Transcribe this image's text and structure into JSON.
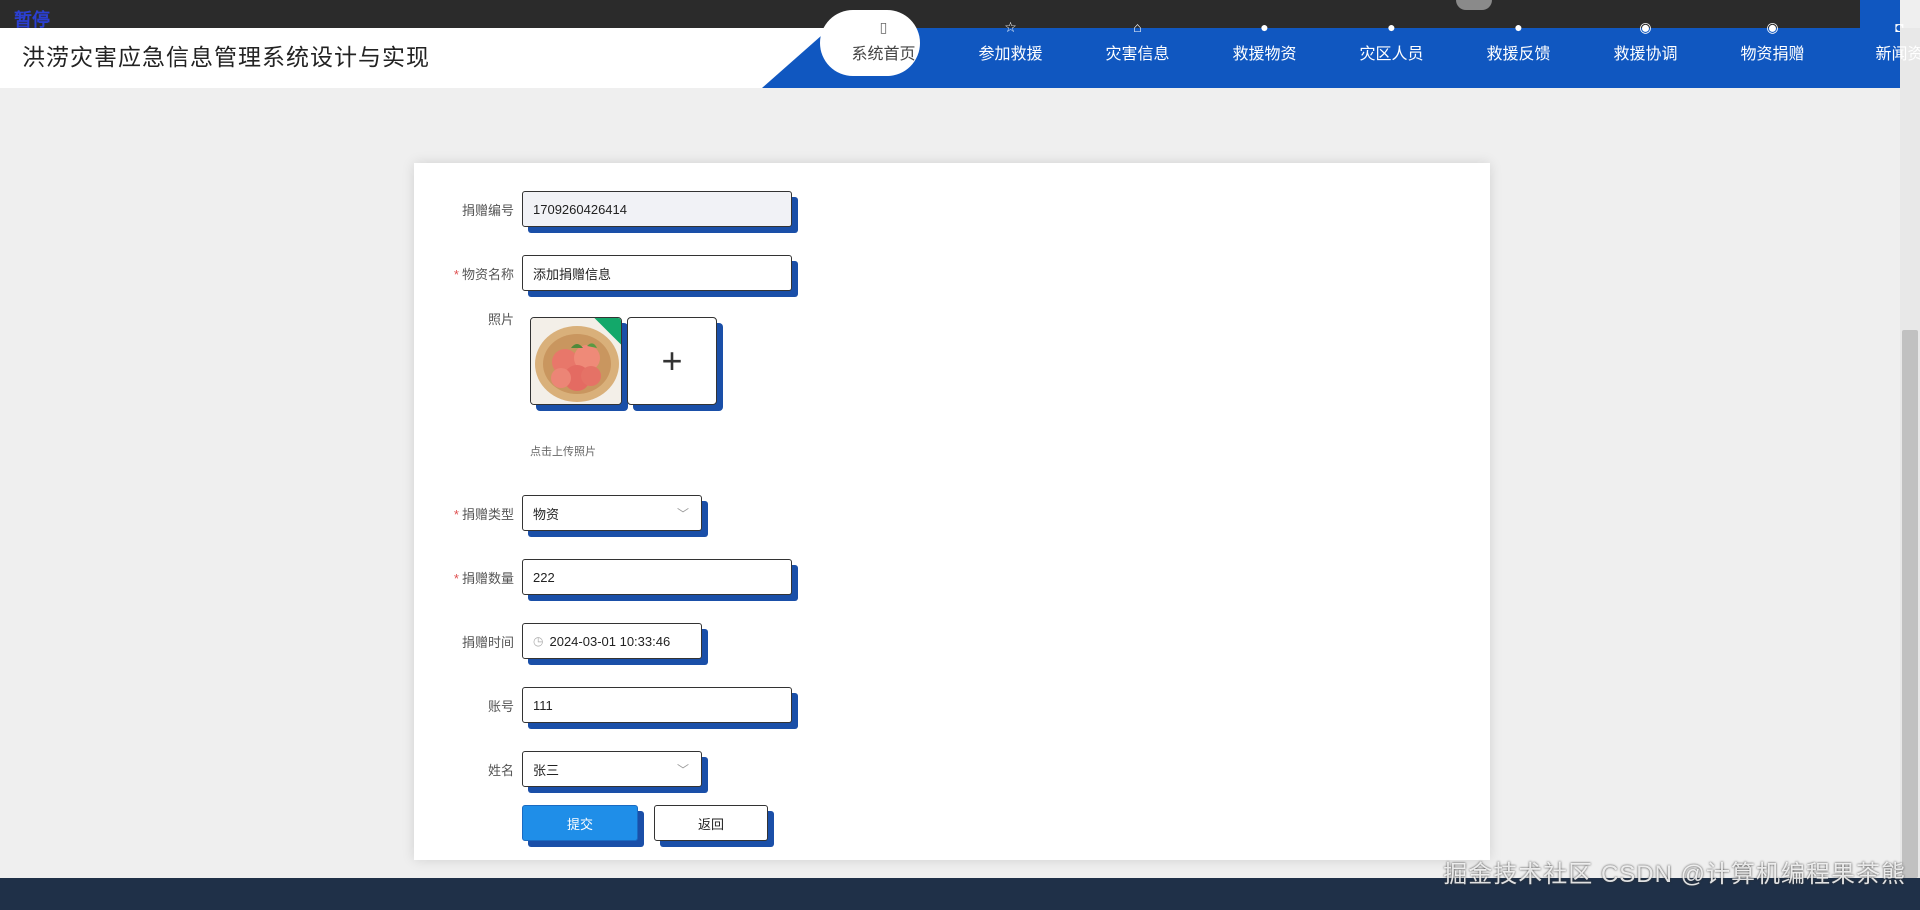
{
  "overlay": {
    "pause_label": "暂停"
  },
  "header": {
    "title": "洪涝灾害应急信息管理系统设计与实现",
    "nav": [
      {
        "label": "系统首页",
        "icon": "home-icon",
        "active": true
      },
      {
        "label": "参加救援",
        "icon": "star-icon",
        "active": false
      },
      {
        "label": "灾害信息",
        "icon": "building-icon",
        "active": false
      },
      {
        "label": "救援物资",
        "icon": "info-icon",
        "active": false
      },
      {
        "label": "灾区人员",
        "icon": "info-icon",
        "active": false
      },
      {
        "label": "救援反馈",
        "icon": "info-icon",
        "active": false
      },
      {
        "label": "救援协调",
        "icon": "shield-icon",
        "active": false
      },
      {
        "label": "物资捐赠",
        "icon": "shield-icon",
        "active": false
      },
      {
        "label": "新闻资",
        "icon": "camera-icon",
        "active": false
      }
    ]
  },
  "form": {
    "donation_no": {
      "label": "捐赠编号",
      "value": "1709260426414"
    },
    "item_name": {
      "label": "物资名称",
      "value": "添加捐赠信息",
      "required": true
    },
    "photo": {
      "label": "照片",
      "tip": "点击上传照片",
      "add_symbol": "+"
    },
    "donation_type": {
      "label": "捐赠类型",
      "value": "物资",
      "required": true
    },
    "donation_qty": {
      "label": "捐赠数量",
      "value": "222",
      "required": true
    },
    "donation_time": {
      "label": "捐赠时间",
      "value": "2024-03-01 10:33:46"
    },
    "account": {
      "label": "账号",
      "value": "111"
    },
    "name": {
      "label": "姓名",
      "value": "张三"
    },
    "buttons": {
      "submit": "提交",
      "back": "返回"
    }
  },
  "watermark": "CSDN @计算机编程果茶熊",
  "watermark2": "掘金技术社区",
  "colors": {
    "brand_blue": "#1057c0",
    "shadow_blue": "#1a4fa8",
    "submit_blue": "#1f8ee8"
  }
}
